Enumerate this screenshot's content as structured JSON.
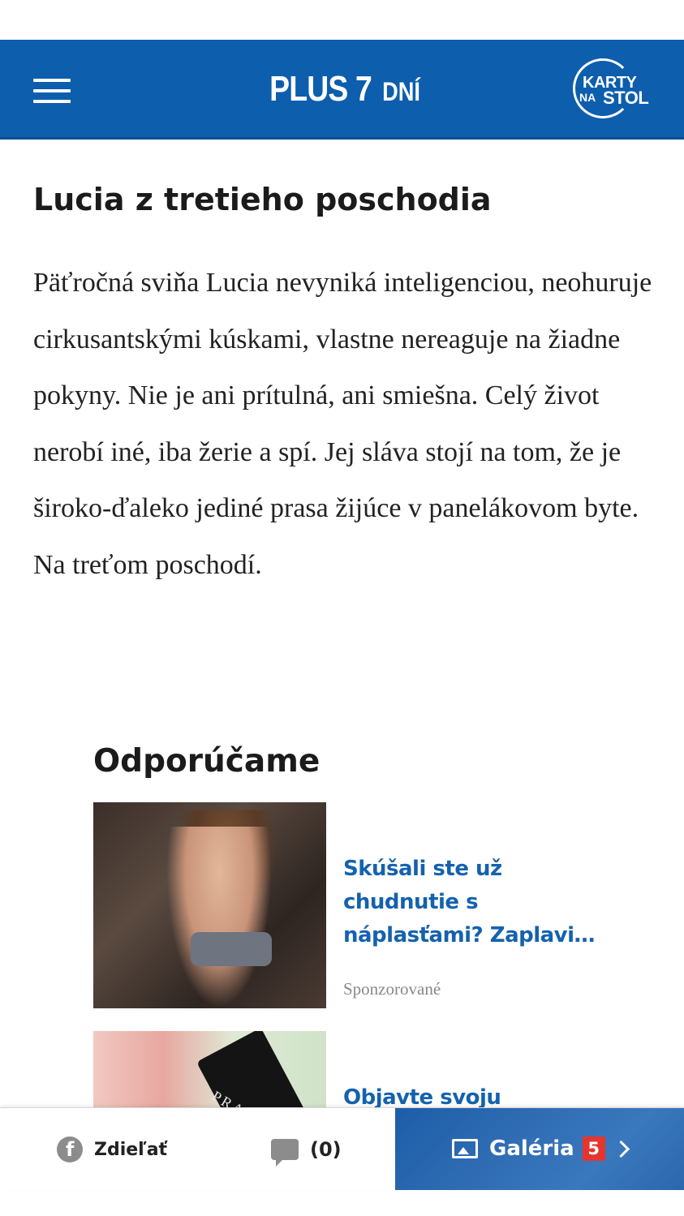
{
  "header": {
    "logo_main": "PLUS 7",
    "logo_sub": "DNÍ",
    "badge_line1": "KARTY",
    "badge_line2": "NA",
    "badge_line3": "STOL"
  },
  "article": {
    "title": "Lucia z tretieho poschodia",
    "body": "Päťročná sviňa Lucia nevyniká inteligenciou, neohuruje cirkusantskými kúskami, vlastne nereaguje na žiadne pokyny. Nie je ani prítulná, ani smiešna. Celý život nerobí iné, iba žerie a spí. Jej sláva stojí na tom, že je široko-ďaleko jediné prasa žijúce v panelákovom byte. Na treťom poschodí."
  },
  "recommended": {
    "heading": "Odporúčame",
    "items": [
      {
        "title": "Skúšali ste už chudnutie s náplasťami? Zaplavi…",
        "sponsored": "Sponzorované"
      },
      {
        "title": "Objavte svoju",
        "image_text": "PRADA"
      }
    ]
  },
  "bottombar": {
    "share_label": "Zdieľať",
    "comments_count": "(0)",
    "gallery_label": "Galéria",
    "gallery_count": "5"
  },
  "colors": {
    "brand_blue": "#0d5ead",
    "link_blue": "#1462ae",
    "badge_red": "#e5352e"
  },
  "icons": [
    "menu-icon",
    "facebook-icon",
    "comment-icon",
    "gallery-icon",
    "chevron-right-icon"
  ]
}
